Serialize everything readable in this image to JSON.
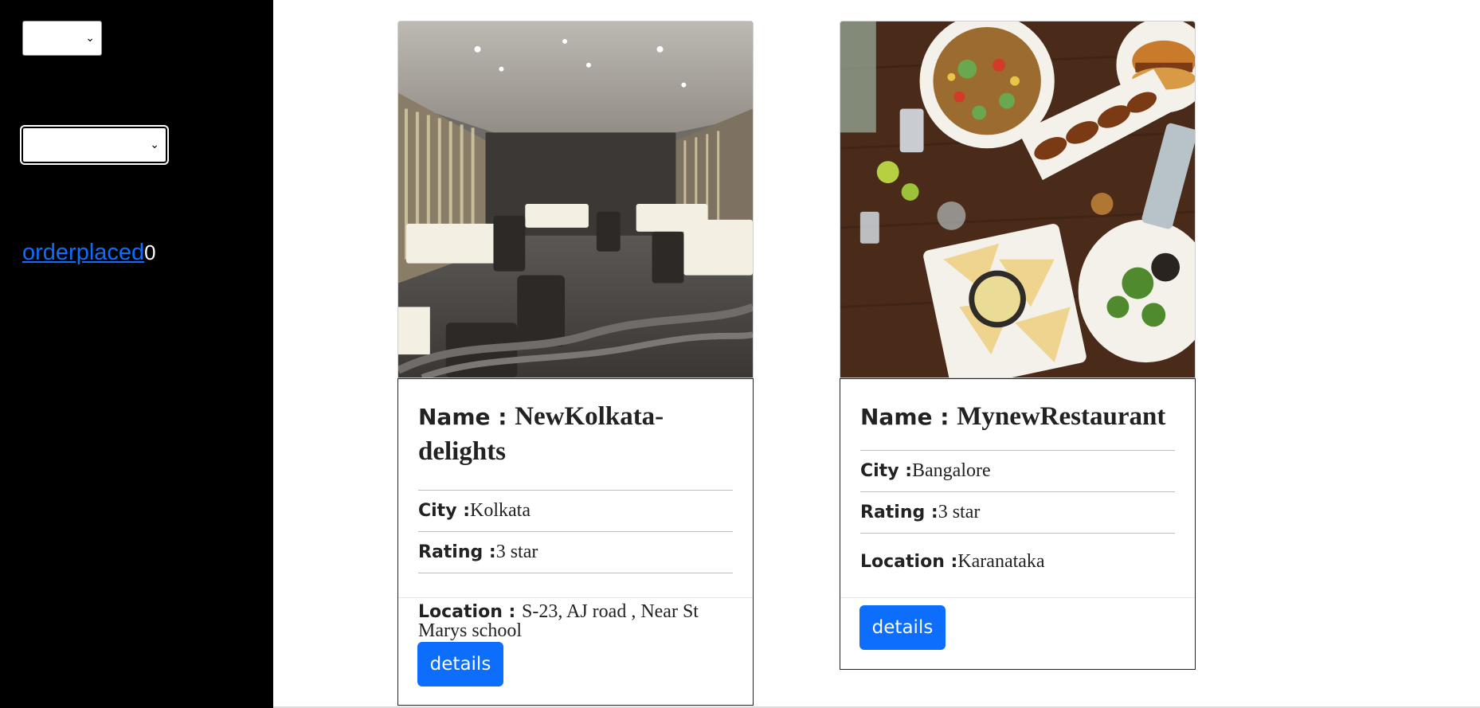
{
  "sidebar": {
    "order_link": "orderplaced",
    "order_count": "0"
  },
  "cards": [
    {
      "name_label": "Name : ",
      "name": "NewKolkata-delights",
      "city_label": "City : ",
      "city": "Kolkata",
      "rating_label": "Rating :",
      "rating": "3 star",
      "location_label": "Location : ",
      "location": "S-23, AJ road , Near St Marys school",
      "button_label": "details"
    },
    {
      "name_label": "Name : ",
      "name": "MynewRestaurant",
      "city_label": "City : ",
      "city": "Bangalore",
      "rating_label": "Rating :",
      "rating": "3 star",
      "location_label": "Location : ",
      "location": "Karanataka",
      "button_label": "details"
    }
  ],
  "colors": {
    "sidebar_bg": "#000000",
    "link": "#0d6efd",
    "button": "#0d6efd"
  }
}
